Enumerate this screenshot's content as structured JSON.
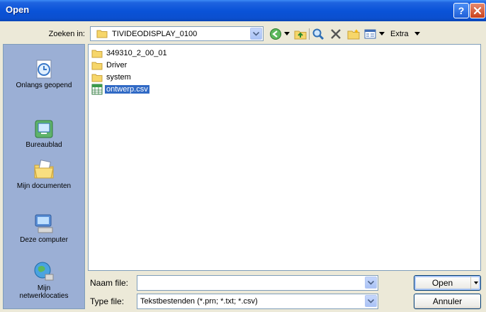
{
  "window": {
    "title": "Open"
  },
  "lookin": {
    "label": "Zoeken in:",
    "value": "TIVIDEODISPLAY_0100"
  },
  "toolbar": {
    "extra_label": "Extra"
  },
  "places": [
    {
      "label": "Onlangs geopend"
    },
    {
      "label": "Bureaublad"
    },
    {
      "label": "Mijn documenten"
    },
    {
      "label": "Deze computer"
    },
    {
      "label": "Mijn netwerklocaties"
    }
  ],
  "files": [
    {
      "name": "349310_2_00_01",
      "type": "folder",
      "selected": false
    },
    {
      "name": "Driver",
      "type": "folder",
      "selected": false
    },
    {
      "name": "system",
      "type": "folder",
      "selected": false
    },
    {
      "name": "ontwerp.csv",
      "type": "csv",
      "selected": true
    }
  ],
  "filename": {
    "label": "Naam file:",
    "value": ""
  },
  "filetype": {
    "label": "Type file:",
    "value": "Tekstbestenden (*.prn; *.txt; *.csv)"
  },
  "buttons": {
    "open": "Open",
    "cancel": "Annuler"
  },
  "colors": {
    "titlebar": "#0a53d8",
    "selection": "#316ac5",
    "places_bg": "#9bafd5"
  }
}
